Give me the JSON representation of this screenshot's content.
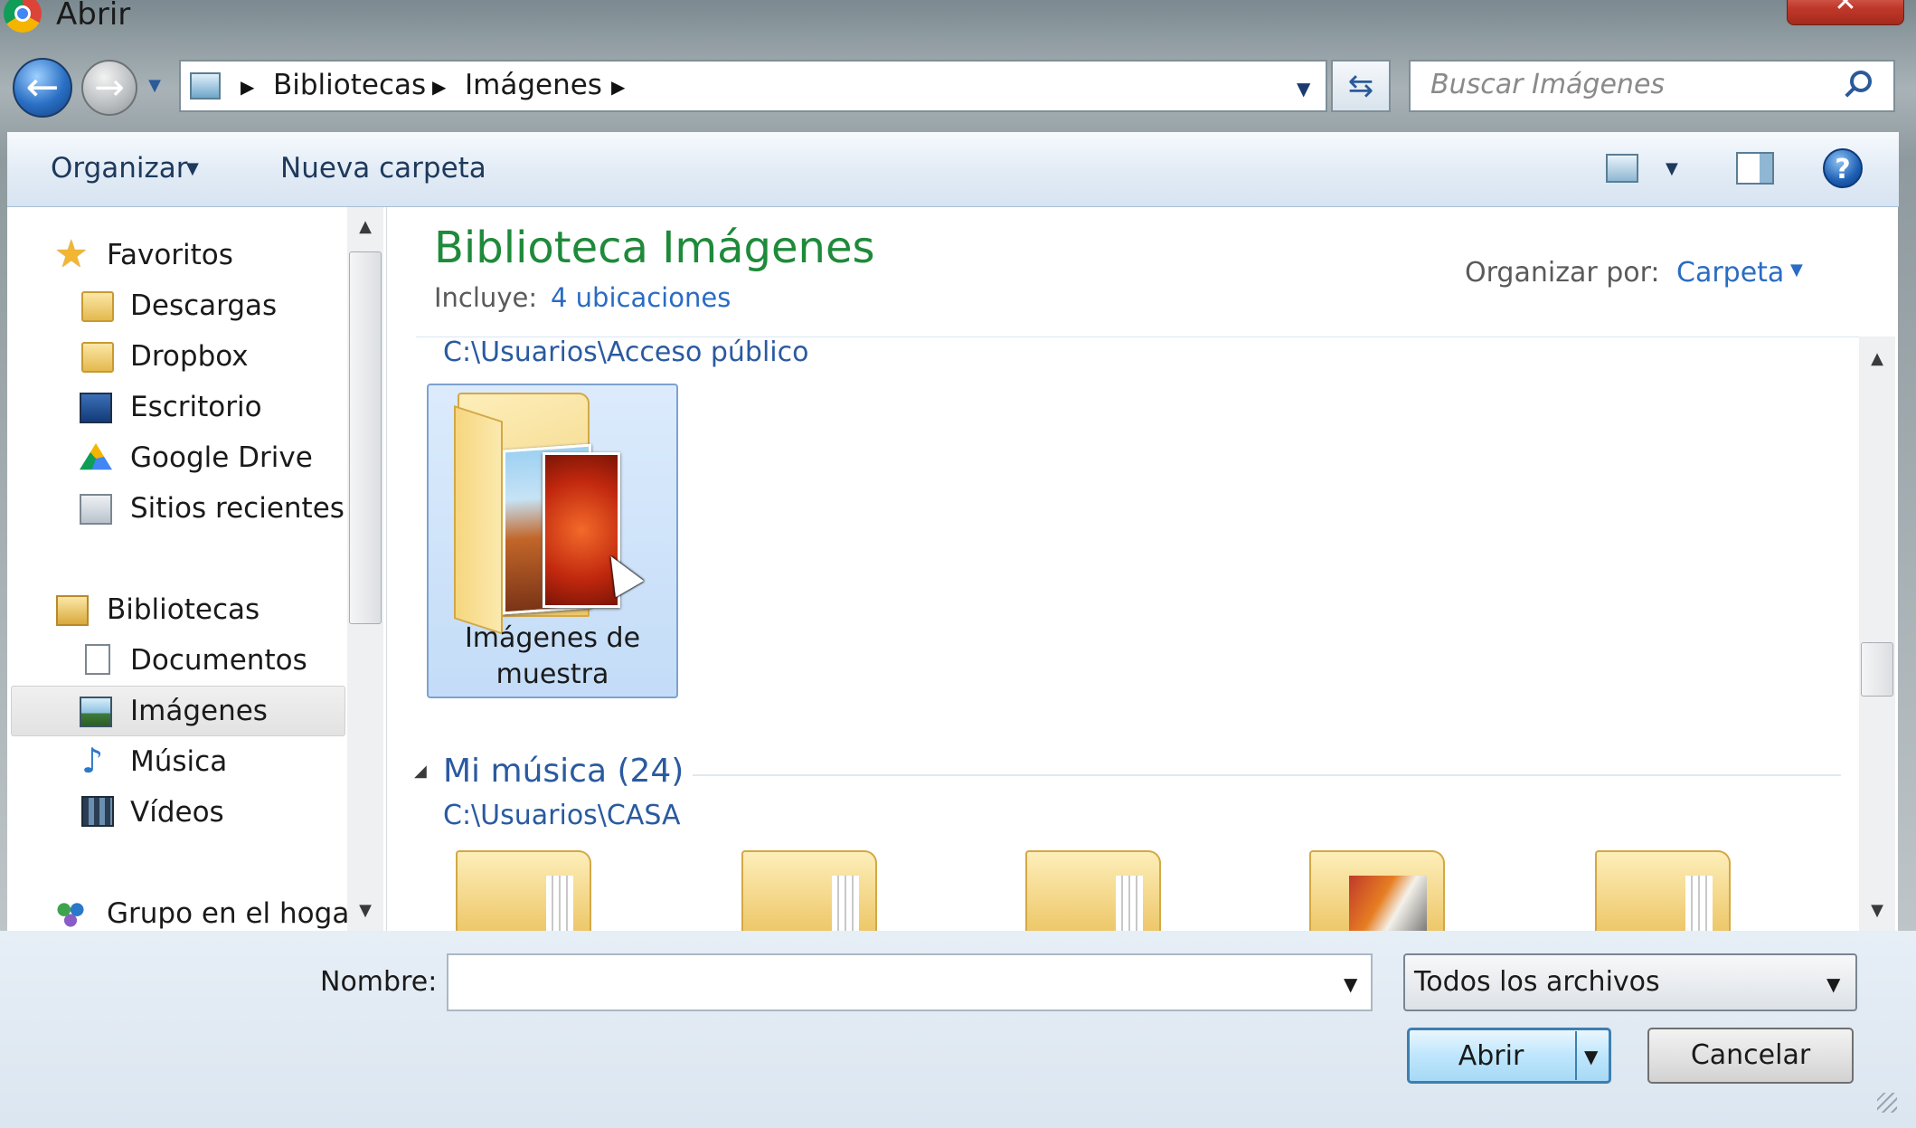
{
  "window": {
    "title": "Abrir",
    "close_label": "✕"
  },
  "address": {
    "breadcrumbs": [
      "Bibliotecas",
      "Imágenes"
    ],
    "search_placeholder": "Buscar Imágenes"
  },
  "toolbar": {
    "organize_label": "Organizar",
    "new_folder_label": "Nueva carpeta",
    "help_label": "?"
  },
  "nav": {
    "favorites_label": "Favoritos",
    "favorites": [
      "Descargas",
      "Dropbox",
      "Escritorio",
      "Google Drive",
      "Sitios recientes"
    ],
    "libraries_label": "Bibliotecas",
    "libraries": [
      "Documentos",
      "Imágenes",
      "Música",
      "Vídeos"
    ],
    "selected": "Imágenes",
    "homegroup_label": "Grupo en el hogar"
  },
  "content": {
    "title": "Biblioteca Imágenes",
    "includes_label": "Incluye:",
    "includes_link": "4 ubicaciones",
    "arrange_by_label": "Organizar por:",
    "arrange_by_value": "Carpeta",
    "group1_path": "C:\\Usuarios\\Acceso público",
    "group1_items": [
      {
        "label_line1": "Imágenes de",
        "label_line2": "muestra",
        "selected": true
      }
    ],
    "group2_title": "Mi música (24)",
    "group2_path": "C:\\Usuarios\\CASA"
  },
  "bottom": {
    "name_label": "Nombre:",
    "name_value": "",
    "file_type": "Todos los archivos",
    "open_label": "Abrir",
    "cancel_label": "Cancelar"
  },
  "colors": {
    "title_green": "#1e8a3a",
    "link_blue": "#2a6cc4",
    "toolbar_text": "#1e395b",
    "selection_fill": "#c3dcf7"
  }
}
